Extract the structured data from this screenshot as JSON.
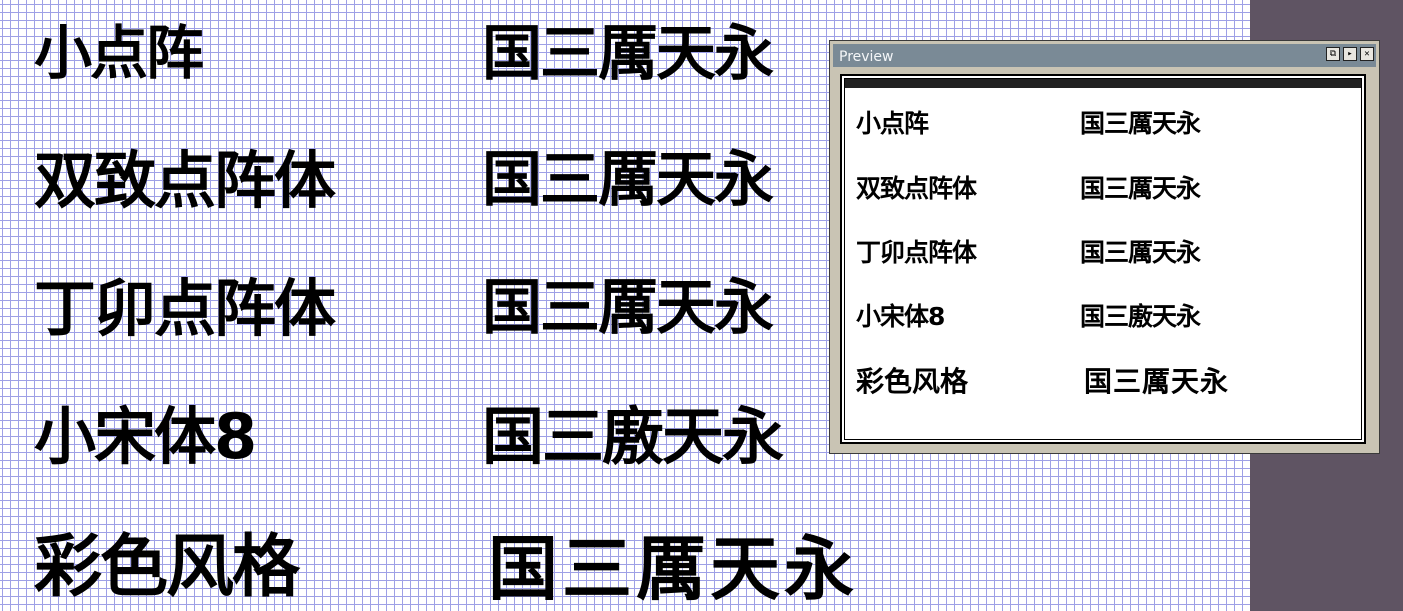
{
  "canvas": {
    "rows": [
      {
        "name": "小点阵",
        "sample": "国三厲天永"
      },
      {
        "name": "双致点阵体",
        "sample": "国三厲天永"
      },
      {
        "name": "丁卯点阵体",
        "sample": "国三厲天永"
      },
      {
        "name": "小宋体8",
        "sample": "国三廒天永"
      },
      {
        "name": "彩色风格",
        "sample": "国三厲天永"
      }
    ]
  },
  "preview": {
    "title": "Preview",
    "buttons": [
      "⧉",
      "▸",
      "✕"
    ],
    "rows": [
      {
        "name": "小点阵",
        "sample": "国三厲天永"
      },
      {
        "name": "双致点阵体",
        "sample": "国三厲天永"
      },
      {
        "name": "丁卯点阵体",
        "sample": "国三厲天永"
      },
      {
        "name": "小宋体8",
        "sample": "国三廒天永"
      },
      {
        "name": "彩色风格",
        "sample": "国三厲天永"
      }
    ]
  },
  "colors": {
    "grid_minor": "#9ea0e6",
    "grid_major": "#2e2eb8",
    "workspace": "#5f5463",
    "titlebar": "#7a8a96"
  }
}
